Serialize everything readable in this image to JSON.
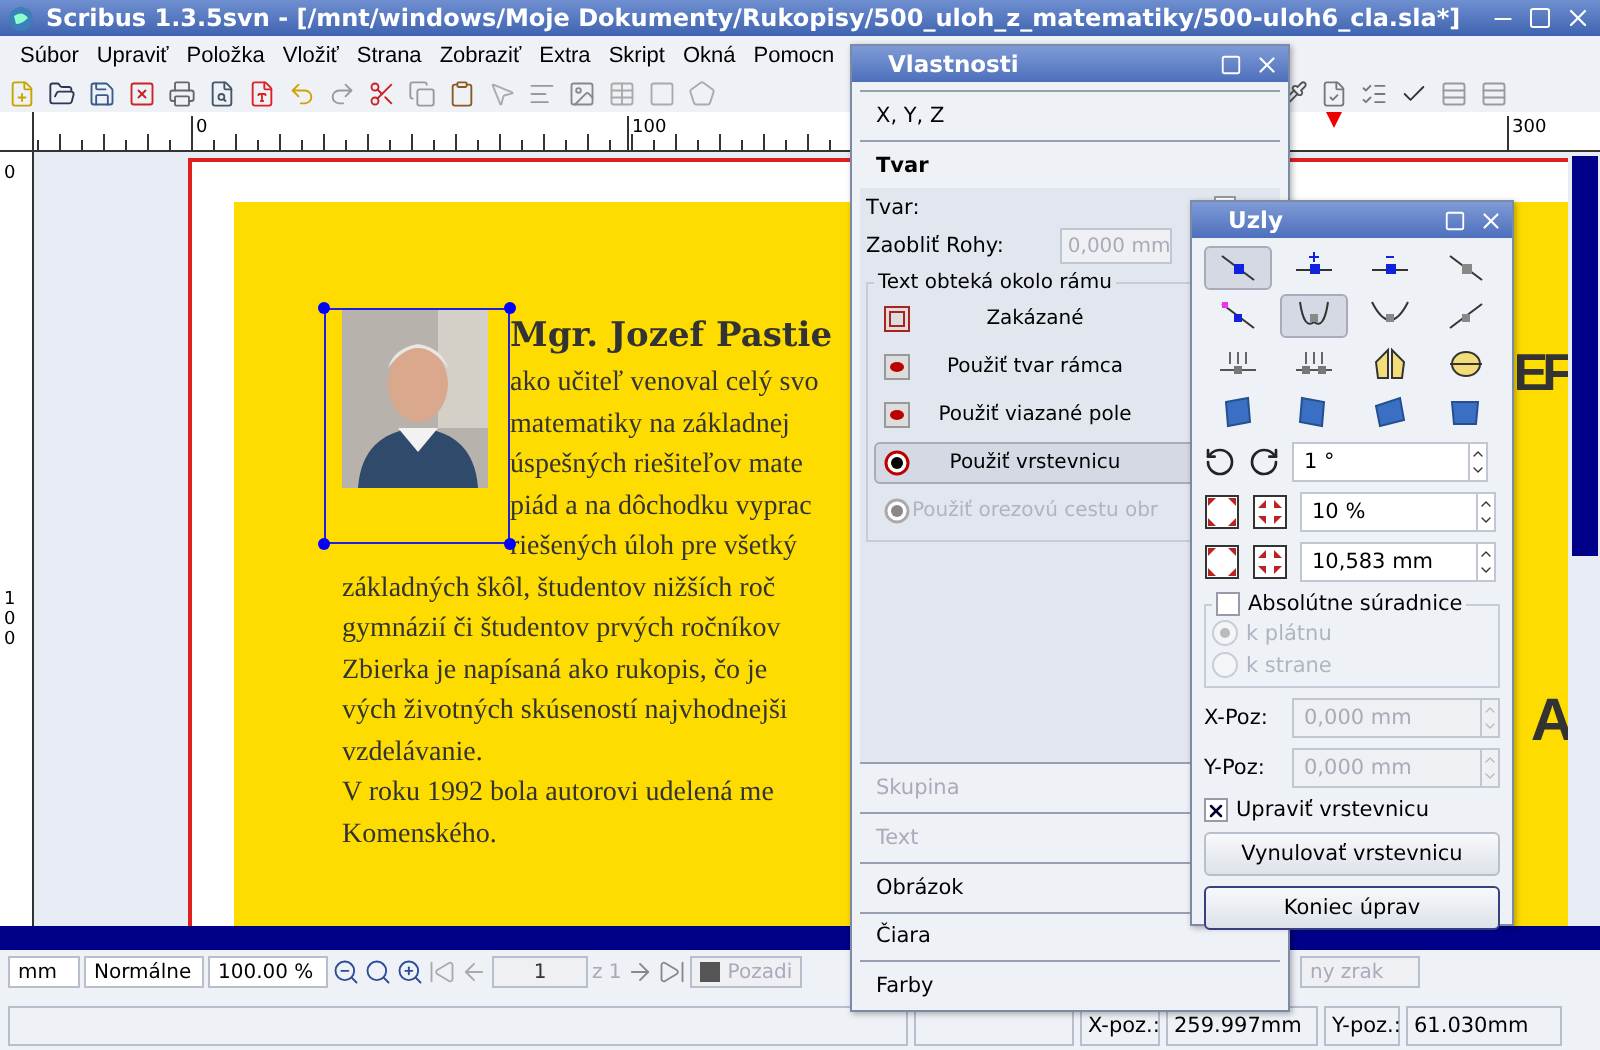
{
  "window": {
    "title": "Scribus 1.3.5svn - [/mnt/windows/Moje Dokumenty/Rukopisy/500_uloh_z_matematiky/500-uloh6_cla.sla*]"
  },
  "menu": [
    "Súbor",
    "Upraviť",
    "Položka",
    "Vložiť",
    "Strana",
    "Zobraziť",
    "Extra",
    "Skript",
    "Okná",
    "Pomocn"
  ],
  "ruler": {
    "horizontal": [
      "0",
      "100",
      "300"
    ],
    "vertical": [
      "0",
      "100"
    ]
  },
  "document": {
    "heading": "Mgr. Jozef Pastie",
    "wrapped_lines": [
      "ako učiteľ venoval celý svo",
      "matematiky na základnej",
      "úspešných riešiteľov mate",
      "piád a na dôchodku vyprac",
      "riešených úloh pre všetký"
    ],
    "full_lines": [
      "základných škôl, študentov nižších roč",
      "gymnázií či študentov prvých ročníkov",
      "Zbierka je napísaná ako rukopis, čo je",
      "vých životných skúseností najvhodnejši",
      "vzdelávanie.",
      "V roku 1992 bola autorovi udelená me",
      "Komenského."
    ],
    "side_letters": [
      "EF",
      "A"
    ]
  },
  "bottom_bar": {
    "unit": "mm",
    "mode": "Normálne",
    "zoom": "100.00 %",
    "page": "1",
    "page_count": "z 1",
    "layer": "Pozadi",
    "view": "ny zrak"
  },
  "status_bar": {
    "x_label": "X-poz.:",
    "x_value": "259.997mm",
    "y_label": "Y-poz.:",
    "y_value": "61.030mm"
  },
  "properties": {
    "title": "Vlastnosti",
    "sections_top": [
      {
        "label": "X, Y, Z",
        "expanded": false
      },
      {
        "label": "Tvar",
        "expanded": true
      }
    ],
    "shape_label": "Tvar:",
    "corner_label": "Zaobliť Rohy:",
    "corner_value": "0,000 mm",
    "wrap_group": "Text obteká okolo rámu",
    "wrap_options": [
      {
        "label": "Zakázané",
        "kind": "square",
        "selected": false,
        "disabled": false
      },
      {
        "label": "Použiť tvar rámca",
        "kind": "dot",
        "selected": false,
        "disabled": false
      },
      {
        "label": "Použiť viazané pole",
        "kind": "dot",
        "selected": false,
        "disabled": false
      },
      {
        "label": "Použiť vrstevnicu",
        "kind": "ring",
        "selected": true,
        "disabled": false
      },
      {
        "label": "Použiť orezovú cestu obr",
        "kind": "ring",
        "selected": false,
        "disabled": true
      }
    ],
    "sections_bottom": [
      {
        "label": "Skupina",
        "disabled": true
      },
      {
        "label": "Text",
        "disabled": true
      },
      {
        "label": "Obrázok",
        "disabled": false
      },
      {
        "label": "Čiara",
        "disabled": false
      },
      {
        "label": "Farby",
        "disabled": false
      }
    ]
  },
  "nodes": {
    "title": "Uzly",
    "tools": [
      {
        "selected": true
      },
      {
        "selected": false
      },
      {
        "selected": false
      },
      {
        "selected": false
      },
      {
        "selected": false
      },
      {
        "selected": true
      },
      {
        "selected": false
      },
      {
        "selected": false
      },
      {
        "selected": false
      },
      {
        "selected": false
      },
      {
        "selected": false
      },
      {
        "selected": false
      },
      {
        "selected": false
      },
      {
        "selected": false
      },
      {
        "selected": false
      },
      {
        "selected": false
      }
    ],
    "rotation": "1 °",
    "scale_percent": "10 %",
    "scale_length": "10,583 mm",
    "absolute": {
      "label": "Absolútne súradnice",
      "checked": false
    },
    "origin": [
      {
        "label": "k plátnu",
        "selected": true,
        "disabled": true
      },
      {
        "label": "k strane",
        "selected": false,
        "disabled": true
      }
    ],
    "x_label": "X-Poz:",
    "x_value": "0,000 mm",
    "y_label": "Y-Poz:",
    "y_value": "0,000 mm",
    "edit_contour": {
      "label": "Upraviť vrstevnicu",
      "checked": true
    },
    "buttons": [
      "Vynulovať vrstevnicu",
      "Koniec úprav"
    ]
  }
}
